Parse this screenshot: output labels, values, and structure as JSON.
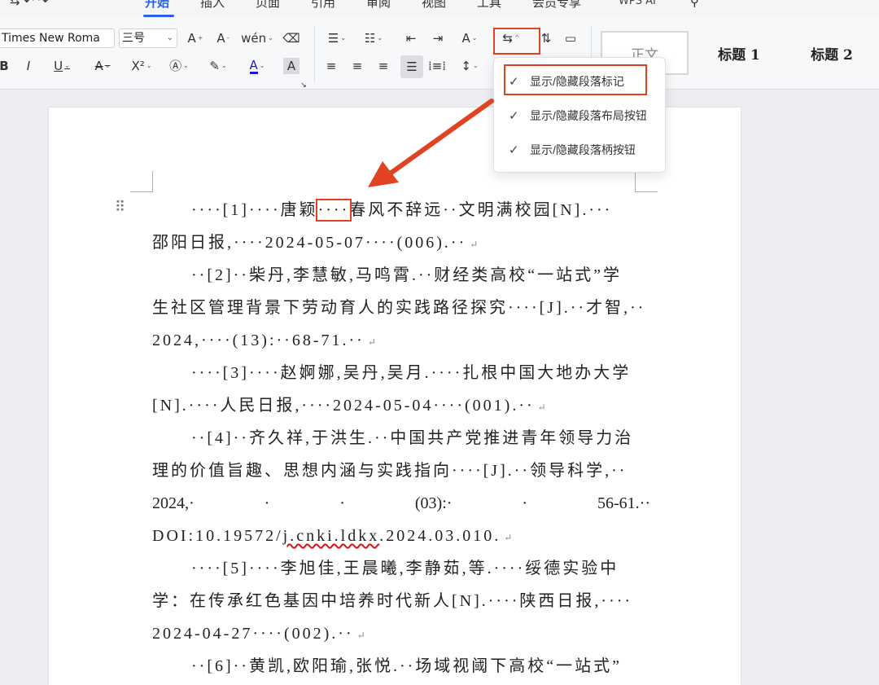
{
  "tabs": [
    {
      "label": "开始",
      "active": true
    },
    {
      "label": "插入"
    },
    {
      "label": "页面"
    },
    {
      "label": "引用"
    },
    {
      "label": "审阅"
    },
    {
      "label": "视图"
    },
    {
      "label": "工具"
    },
    {
      "label": "会员专享"
    },
    {
      "label": "WPS AI"
    }
  ],
  "toolbar": {
    "font_name": "Times New Roma",
    "font_size": "三号",
    "styles": [
      "正文",
      "标题 1",
      "标题 2"
    ]
  },
  "menu": {
    "items": [
      {
        "label": "显示/隐藏段落标记",
        "checked": true,
        "highlighted": true
      },
      {
        "label": "显示/隐藏段落布局按钮",
        "checked": true
      },
      {
        "label": "显示/隐藏段落柄按钮",
        "checked": true
      }
    ]
  },
  "document": {
    "lines": [
      {
        "pre": "····[1]····唐颖",
        "hl": "····",
        "post": "春风不辞远··文明满校园[N].···",
        "indent": true
      },
      {
        "text": "邵阳日报,····2024-05-07····(006).··",
        "ret": true
      },
      {
        "text": "··[2]··柴丹,李慧敏,马鸣霄.··财经类高校“一站式”学",
        "indent": true
      },
      {
        "text": "生社区管理背景下劳动育人的实践路径探究····[J].··才智,··"
      },
      {
        "text": "2024,····(13):··68-71.··",
        "ret": true
      },
      {
        "text": "····[3]····赵婀娜,吴丹,吴月.····扎根中国大地办大学",
        "indent": true
      },
      {
        "text": "[N].····人民日报,····2024-05-04····(001).··",
        "ret": true
      },
      {
        "text": "··[4]··齐久祥,于洪生.··中国共产党推进青年领导力治",
        "indent": true
      },
      {
        "text": "理的价值旨趣、思想内涵与实践指向····[J].··领导科学,··"
      },
      {
        "cells": [
          "2024,·",
          "·",
          "·",
          "(03):·",
          "·",
          "56-61.··"
        ]
      },
      {
        "pre": "DOI:10.19572/",
        "wavy": "j.cnki.ldkx",
        "post": ".2024.03.010.",
        "ret": true
      },
      {
        "text": "····[5]····李旭佳,王晨曦,李静茹,等.····绥德实验中",
        "indent": true
      },
      {
        "text": "学：在传承红色基因中培养时代新人[N].····陕西日报,····"
      },
      {
        "text": "2024-04-27····(002).··",
        "ret": true
      },
      {
        "text": "··[6]··黄凯,欧阳瑜,张悦.··场域视阈下高校“一站式”",
        "indent": true
      }
    ],
    "return_mark": "↵"
  },
  "colors": {
    "accent": "#2b5fe8",
    "highlight": "#e0431f"
  }
}
